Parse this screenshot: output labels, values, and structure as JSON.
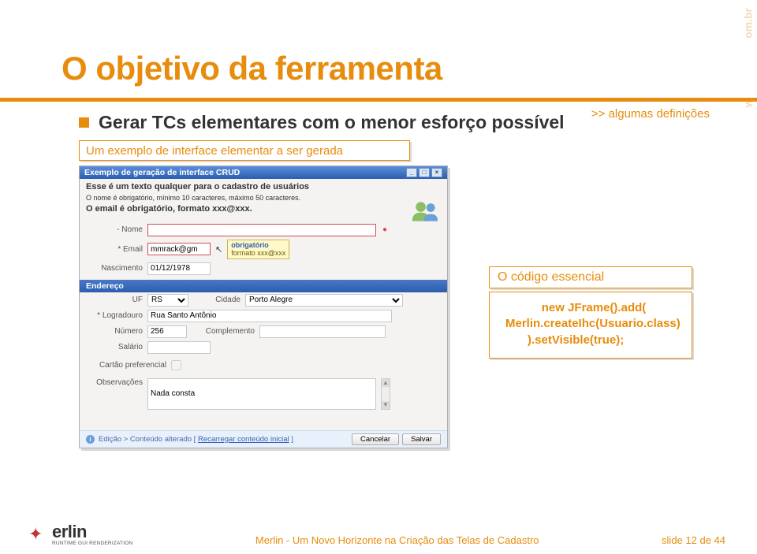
{
  "watermark": "www.3layer.com.br",
  "title": "O objetivo da ferramenta",
  "subtitle_right": ">> algumas definições",
  "bullet": "Gerar TCs elementares com o menor esforço possível",
  "example_caption": "Um exemplo de interface elementar a ser gerada",
  "crud": {
    "window_title": "Exemplo de geração de interface CRUD",
    "intro_bold": "Esse é um texto qualquer para o cadastro de usuários",
    "intro_line1": "O nome é obrigatório, mínimo 10 caracteres, máximo 50 caracteres.",
    "intro_line2": "O email é obrigatório, formato xxx@xxx.",
    "labels": {
      "nome": "- Nome",
      "email": "* Email",
      "nascimento": "Nascimento",
      "endereco_section": "Endereço",
      "uf": "UF",
      "cidade": "Cidade",
      "logradouro": "* Logradouro",
      "numero": "Número",
      "complemento": "Complemento",
      "salario": "Salário",
      "cartao": "Cartão preferencial",
      "observacoes": "Observações"
    },
    "values": {
      "email": "mmrack@gm",
      "nascimento": "01/12/1978",
      "uf": "RS",
      "cidade": "Porto Alegre",
      "logradouro": "Rua Santo Antônio",
      "numero": "256",
      "observacoes": "Nada consta"
    },
    "tooltip": {
      "title": "obrigatório",
      "body": "formato xxx@xxx"
    },
    "status": {
      "text": "Edição > Conteúdo alterado [",
      "link": "Recarregar conteúdo inicial",
      "tail": " ]"
    },
    "buttons": {
      "cancel": "Cancelar",
      "save": "Salvar"
    }
  },
  "code_caption": "O código essencial",
  "code_lines": {
    "l1": "new JFrame().add(",
    "l2": "Merlin.createIhc(Usuario.class)",
    "l3": ").setVisible(true);"
  },
  "footer": {
    "logo_name": "erlin",
    "logo_tag": "RUNTIME GUI RENDERIZATION",
    "center": "Merlin - Um Novo Horizonte na Criação das Telas de Cadastro",
    "right": "slide 12 de 44"
  }
}
